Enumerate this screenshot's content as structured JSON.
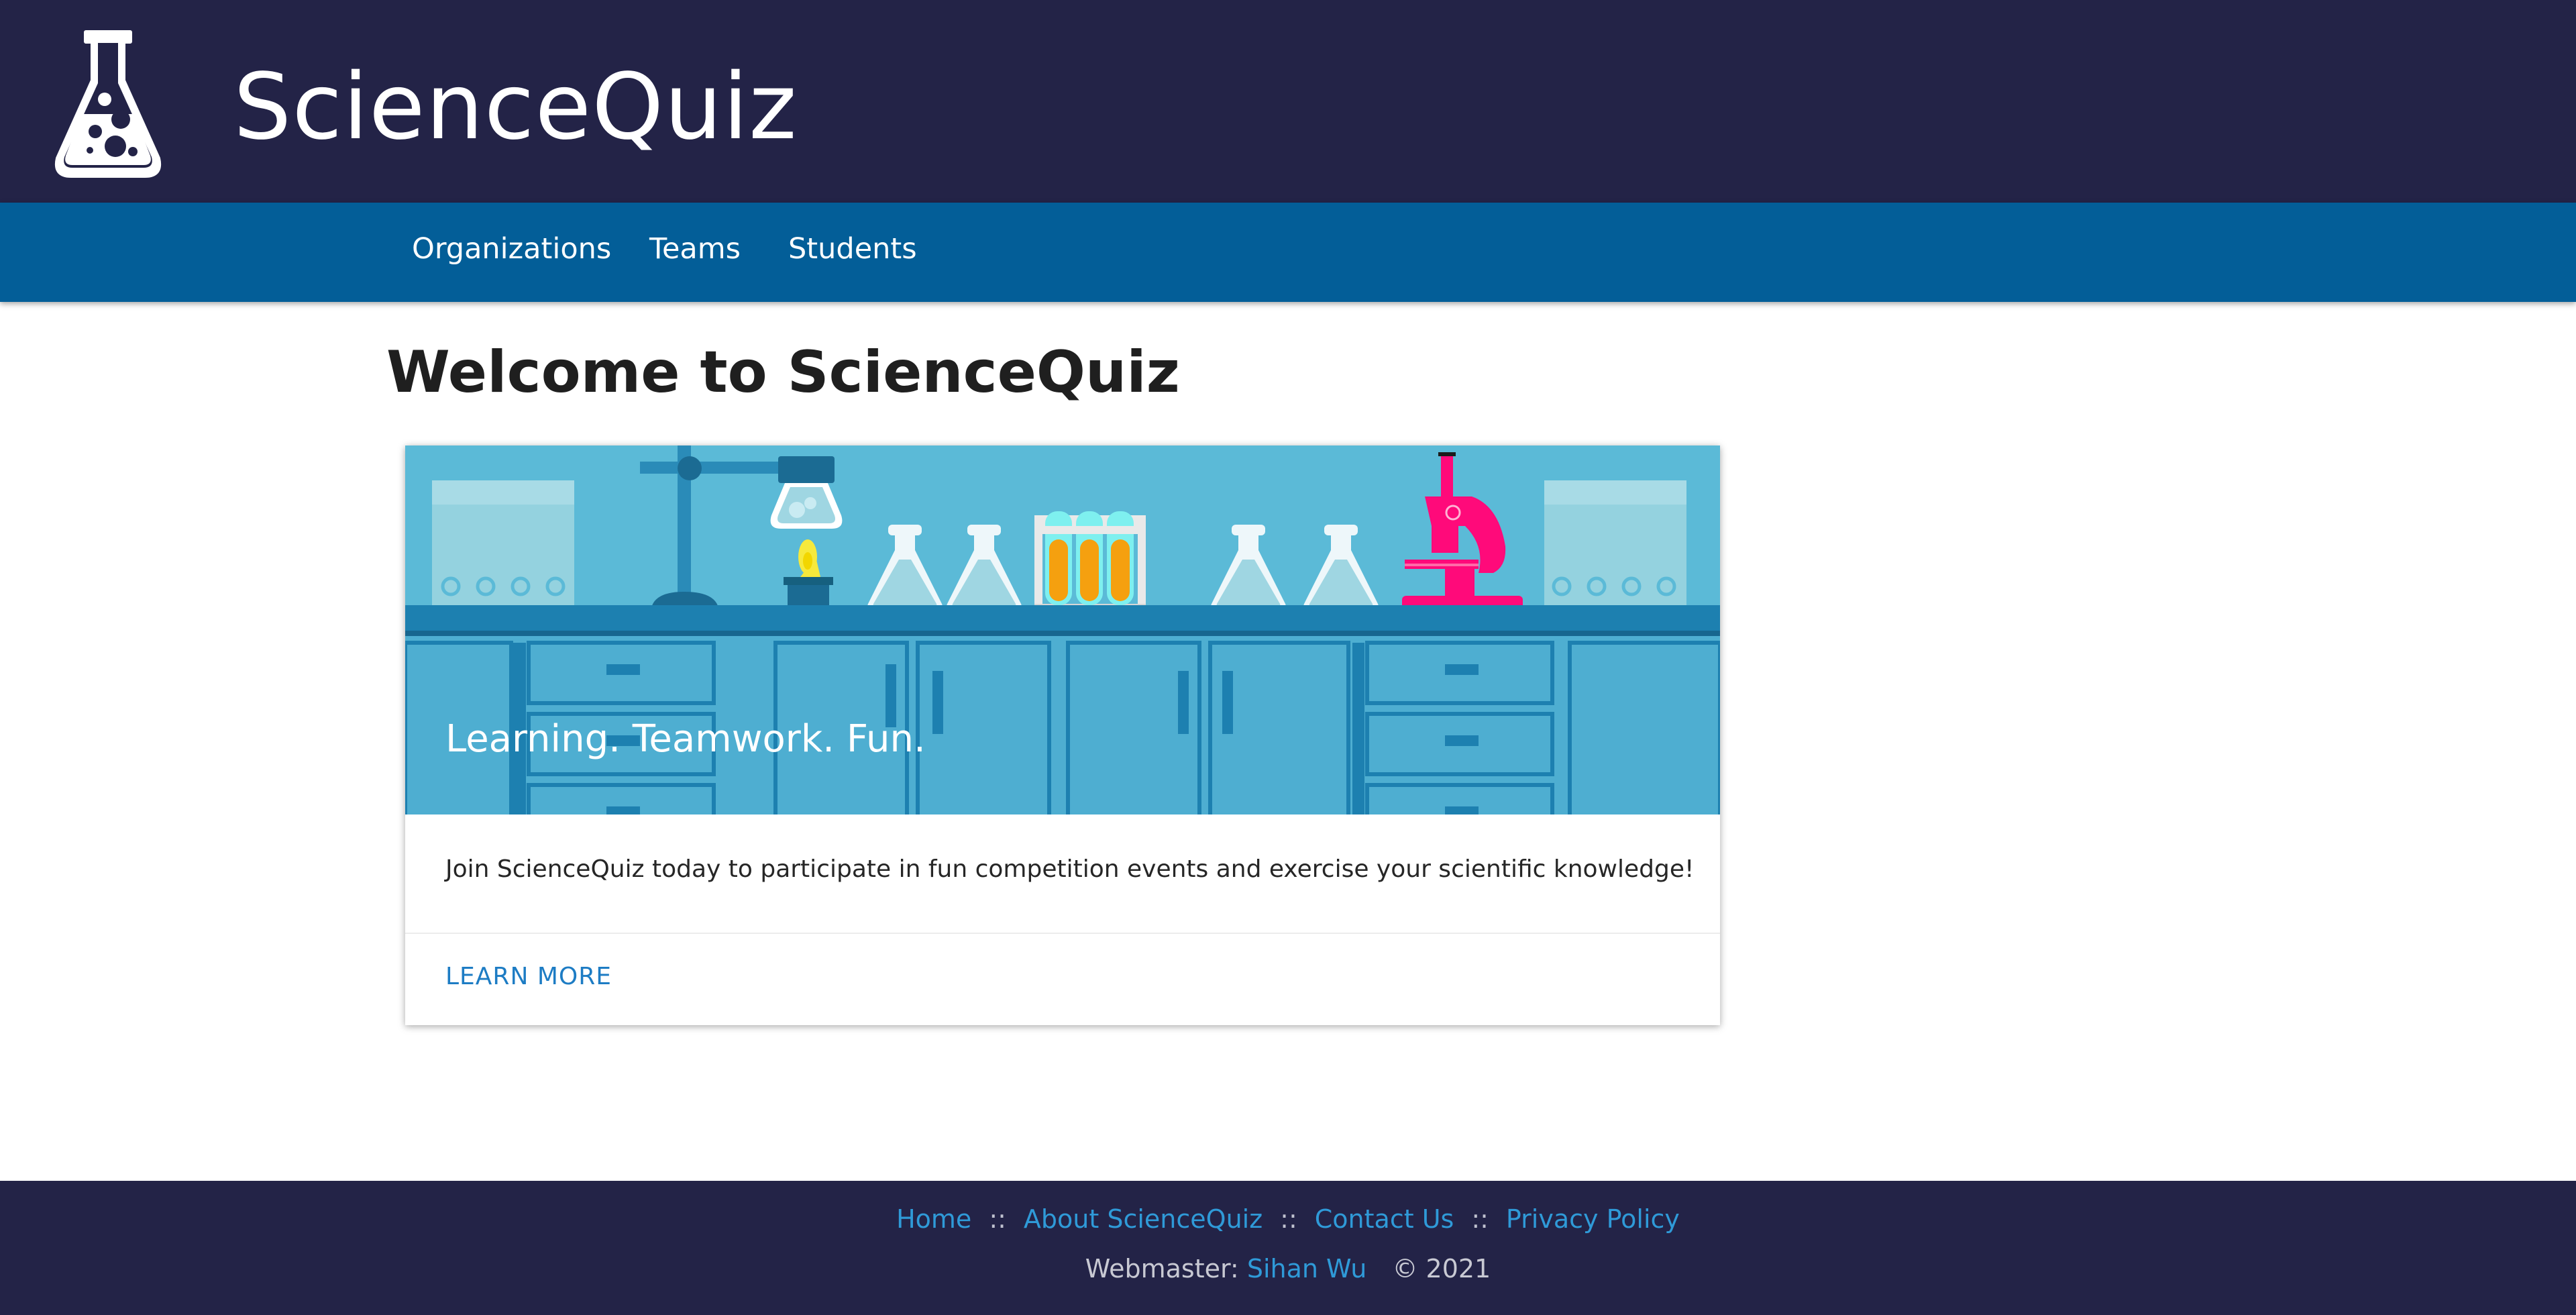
{
  "header": {
    "brand": "ScienceQuiz",
    "logo_icon": "flask-icon"
  },
  "nav": {
    "items": [
      {
        "label": "Organizations"
      },
      {
        "label": "Teams"
      },
      {
        "label": "Students"
      }
    ]
  },
  "main": {
    "title": "Welcome to ScienceQuiz",
    "card": {
      "illustration": "lab-bench-illustration",
      "tagline": "Learning. Teamwork. Fun.",
      "text": "Join ScienceQuiz today to participate in fun competition events and exercise your scientific knowledge!",
      "action_label": "LEARN MORE"
    }
  },
  "footer": {
    "links": [
      {
        "label": "Home"
      },
      {
        "label": "About ScienceQuiz"
      },
      {
        "label": "Contact Us"
      },
      {
        "label": "Privacy Policy"
      }
    ],
    "separator": "::",
    "webmaster_prefix": "Webmaster:",
    "webmaster_name": "Sihan Wu",
    "copyright": "© 2021"
  },
  "colors": {
    "header_bg": "#232347",
    "nav_bg": "#035e98",
    "link": "#2f9ad8",
    "action": "#1d7cc4"
  }
}
